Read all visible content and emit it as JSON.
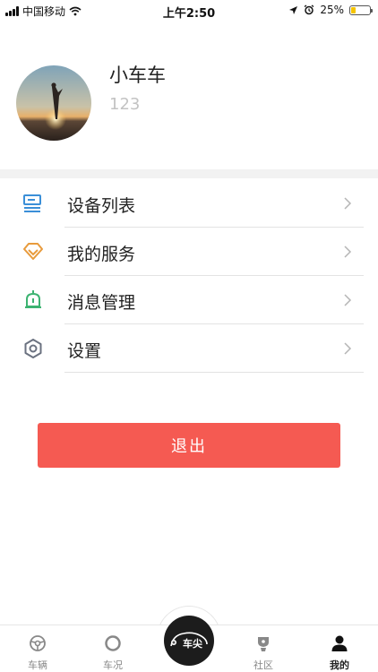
{
  "status_bar": {
    "carrier": "中国移动",
    "time": "上午2:50",
    "battery": "25%",
    "battery_level": 0.25
  },
  "profile": {
    "name": "小车车",
    "id": "123"
  },
  "menu": {
    "items": [
      {
        "label": "设备列表",
        "icon": "device-list-icon",
        "color": "#3b8fd8"
      },
      {
        "label": "我的服务",
        "icon": "diamond-icon",
        "color": "#e89b3c"
      },
      {
        "label": "消息管理",
        "icon": "bell-icon",
        "color": "#3cb371"
      },
      {
        "label": "设置",
        "icon": "settings-hexagon-icon",
        "color": "#6b7280"
      }
    ]
  },
  "logout": {
    "label": "退出",
    "color": "#f55a52"
  },
  "tab_bar": {
    "tabs": [
      {
        "label": "车辆",
        "icon": "steering-wheel-icon",
        "active": false
      },
      {
        "label": "车况",
        "icon": "circle-icon",
        "active": false
      },
      {
        "label": "车尖",
        "icon": "car-logo-icon",
        "active": false
      },
      {
        "label": "社区",
        "icon": "community-icon",
        "active": false
      },
      {
        "label": "我的",
        "icon": "person-icon",
        "active": true
      }
    ]
  }
}
